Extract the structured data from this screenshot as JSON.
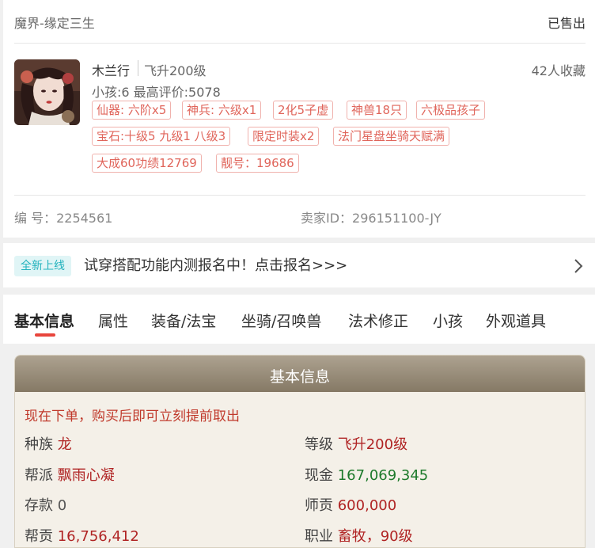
{
  "header": {
    "server": "魔界-缘定三生",
    "status": "已售出"
  },
  "role": {
    "name": "木兰行",
    "level": "飞升200级",
    "favorites": "42人收藏",
    "subline": "小孩:6 最高评价:5078",
    "tags": [
      "仙器: 六阶x5",
      "神兵: 六级x1",
      "2化5子虚",
      "神兽18只",
      "六极品孩子",
      "宝石:十级5 九级1 八级3",
      "限定时装x2",
      "法门星盘坐骑天赋满",
      "大成60功绩12769",
      "靓号：19686"
    ],
    "serial": "编 号：2254561",
    "seller": "卖家ID：296151100-JY"
  },
  "notice": {
    "badge": "全新上线",
    "text": "试穿搭配功能内测报名中！点击报名>>>"
  },
  "tabs": [
    "基本信息",
    "属性",
    "装备/法宝",
    "坐骑/召唤兽",
    "法术修正",
    "小孩",
    "外观道具"
  ],
  "basic": {
    "title": "基本信息",
    "note": "现在下单，购买后即可立刻提前取出",
    "race_label": "种族",
    "race": "龙",
    "grade_label": "等级",
    "grade": "飞升200级",
    "guild_label": "帮派",
    "guild": "飘雨心凝",
    "cash_label": "现金",
    "cash": "167,069,345",
    "deposit_label": "存款",
    "deposit": "0",
    "mentor_label": "师贡",
    "mentor": "600,000",
    "guild_contrib_label": "帮贡",
    "guild_contrib": "16,756,412",
    "job_label": "职业",
    "job": "畜牧，90级"
  },
  "colors": {
    "accent_red": "#e8453c",
    "tag_red": "#e0655b",
    "value_green": "#1d7a2b",
    "badge_teal": "#22b2bd"
  }
}
